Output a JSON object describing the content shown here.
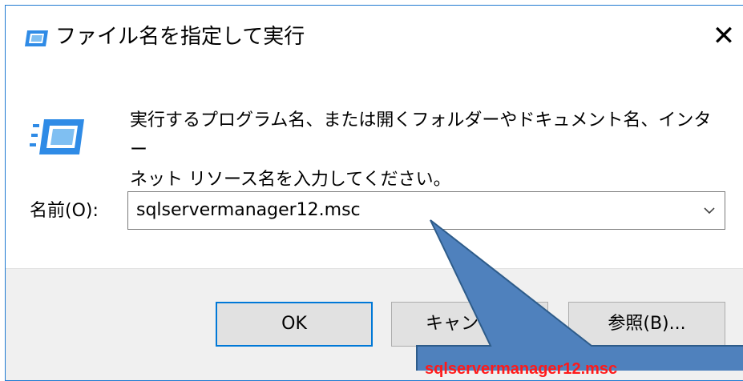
{
  "window": {
    "title": "ファイル名を指定して実行",
    "close_glyph": "✕"
  },
  "content": {
    "description_line1": "実行するプログラム名、または開くフォルダーやドキュメント名、インター",
    "description_line2": "ネット リソース名を入力してください。",
    "name_label": "名前(O):",
    "name_value": "sqlservermanager12.msc"
  },
  "buttons": {
    "ok": "OK",
    "cancel": "キャンセル",
    "browse": "参照(B)..."
  },
  "annotation": {
    "callout_text": "sqlservermanager12.msc",
    "callout_fill": "#4f81bd",
    "callout_text_color": "#ff1a1a"
  },
  "colors": {
    "window_border": "#1f7ad1",
    "default_button_border": "#0078d7",
    "icon_blue": "#2f8be6"
  },
  "icons": {
    "title": "run-dialog-icon",
    "main": "run-program-icon",
    "dropdown": "chevron-down-icon"
  }
}
